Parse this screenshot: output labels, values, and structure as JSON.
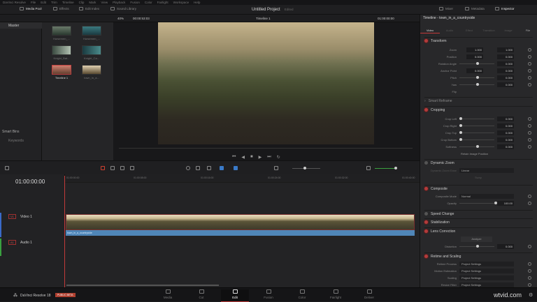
{
  "menu": [
    "DaVinci Resolve",
    "File",
    "Edit",
    "Trim",
    "Timeline",
    "Clip",
    "Mark",
    "View",
    "Playback",
    "Fusion",
    "Color",
    "Fairlight",
    "Workspace",
    "Help"
  ],
  "toolbar": {
    "media_pool": "Media Pool",
    "effects": "Effects",
    "edit_index": "Edit Index",
    "sound_library": "Sound Library",
    "project_title": "Untitled Project",
    "edited": "Edited",
    "mixer": "Mixer",
    "metadata": "Metadata",
    "inspector": "Inspector"
  },
  "viewer": {
    "zoom": "40%",
    "source_timecode": "00:00:53:03",
    "timeline_name": "Timeline 1",
    "record_timecode": "01:00:00:00"
  },
  "media_pool": {
    "sidebar": {
      "master": "Master",
      "smart_bins": "Smart Bins",
      "keywords": "Keywords"
    },
    "clips": [
      {
        "name": "Horsemen_..."
      },
      {
        "name": "Horsemen_..."
      },
      {
        "name": "Knight_Bat..."
      },
      {
        "name": "Knight_Ca..."
      },
      {
        "name": "Timeline 1"
      },
      {
        "name": "town_in_a..."
      }
    ]
  },
  "inspector": {
    "header": "Timeline - town_in_a_countryside",
    "tabs": [
      "Video",
      "Audio",
      "Effect",
      "Transition",
      "Image",
      "File"
    ],
    "transform": {
      "title": "Transform",
      "zoom_label": "Zoom",
      "zoom_x": "1.000",
      "zoom_y": "1.000",
      "position_label": "Position",
      "pos_x": "0.000",
      "pos_y": "0.000",
      "rotation_label": "Rotation Angle",
      "rotation": "0.000",
      "anchor_label": "Anchor Point",
      "anchor_x": "0.000",
      "anchor_y": "0.000",
      "pitch_label": "Pitch",
      "pitch": "0.000",
      "yaw_label": "Yaw",
      "yaw": "0.000",
      "flip_label": "Flip"
    },
    "smart_reframe": "Smart Reframe",
    "cropping": {
      "title": "Cropping",
      "left_label": "Crop Left",
      "left": "0.000",
      "right_label": "Crop Right",
      "right": "0.000",
      "top_label": "Crop Top",
      "top": "0.000",
      "bottom_label": "Crop Bottom",
      "bottom": "0.000",
      "softness_label": "Softness",
      "softness": "0.000",
      "retain": "Retain Image Position"
    },
    "dynamic_zoom": {
      "title": "Dynamic Zoom",
      "ease_label": "Dynamic Zoom Ease",
      "ease": "Linear",
      "swap": "Swap"
    },
    "composite": {
      "title": "Composite",
      "mode_label": "Composite Mode",
      "mode": "Normal",
      "opacity_label": "Opacity",
      "opacity": "100.00"
    },
    "speed_change": "Speed Change",
    "stabilization": "Stabilization",
    "lens": {
      "title": "Lens Correction",
      "analyze": "Analyze",
      "distortion_label": "Distortion",
      "distortion": "0.000"
    },
    "retime": {
      "title": "Retime and Scaling",
      "process_label": "Retime Process",
      "process": "Project Settings",
      "motion_label": "Motion Estimation",
      "motion": "Project Settings",
      "scaling_label": "Scaling",
      "scaling": "Project Settings",
      "resize_label": "Resize Filter",
      "resize": "Project Settings"
    }
  },
  "timeline": {
    "timecode": "01:00:00:00",
    "ruler": [
      "01:00:00:00",
      "01:00:08:00",
      "01:00:16:00",
      "01:00:24:00",
      "01:00:32:00",
      "01:00:40:00"
    ],
    "video_track": {
      "id": "V1",
      "name": "Video 1"
    },
    "audio_track": {
      "id": "A1",
      "name": "Audio 1"
    },
    "clip_name": "town_in_a_countryside"
  },
  "bottom": {
    "app": "DaVinci Resolve 18",
    "badge": "PUBLIC BETA",
    "pages": [
      "Media",
      "Cut",
      "Edit",
      "Fusion",
      "Color",
      "Fairlight",
      "Deliver"
    ],
    "active_page": "Edit",
    "watermark": "wtvid.com"
  }
}
